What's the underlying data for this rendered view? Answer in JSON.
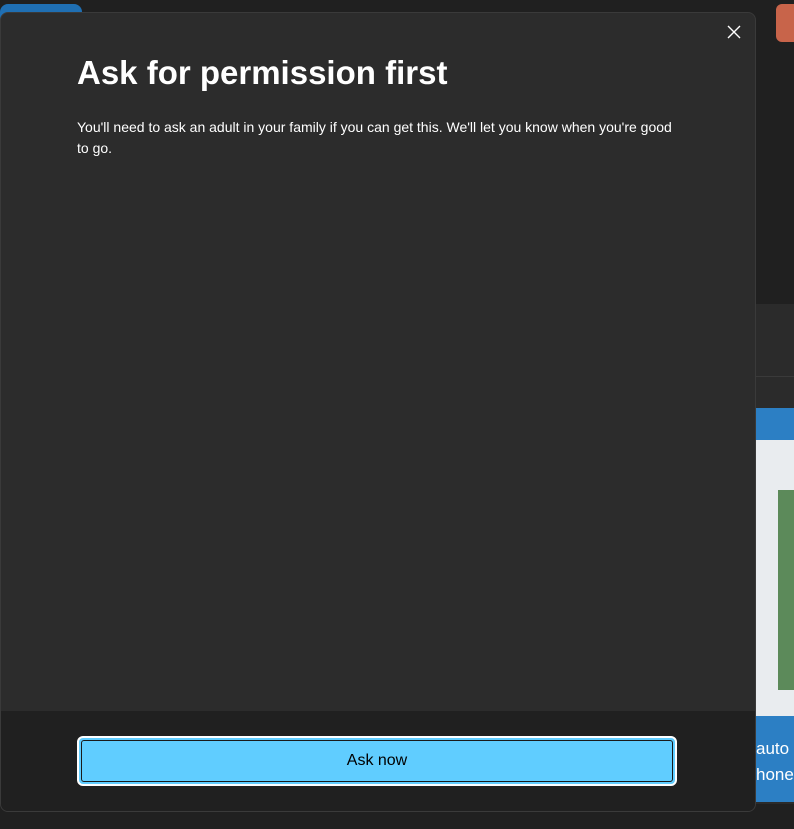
{
  "dialog": {
    "title": "Ask for permission first",
    "body": "You'll need to ask an adult in your family if you can get this. We'll let you know when you're good to go.",
    "close_icon": "close-icon",
    "primary_button_label": "Ask now"
  },
  "background": {
    "partial_text_line1": "auto",
    "partial_text_line2": "hone"
  },
  "colors": {
    "accent": "#60cdff",
    "dialog_bg": "#2c2c2c",
    "footer_bg": "#202020"
  }
}
